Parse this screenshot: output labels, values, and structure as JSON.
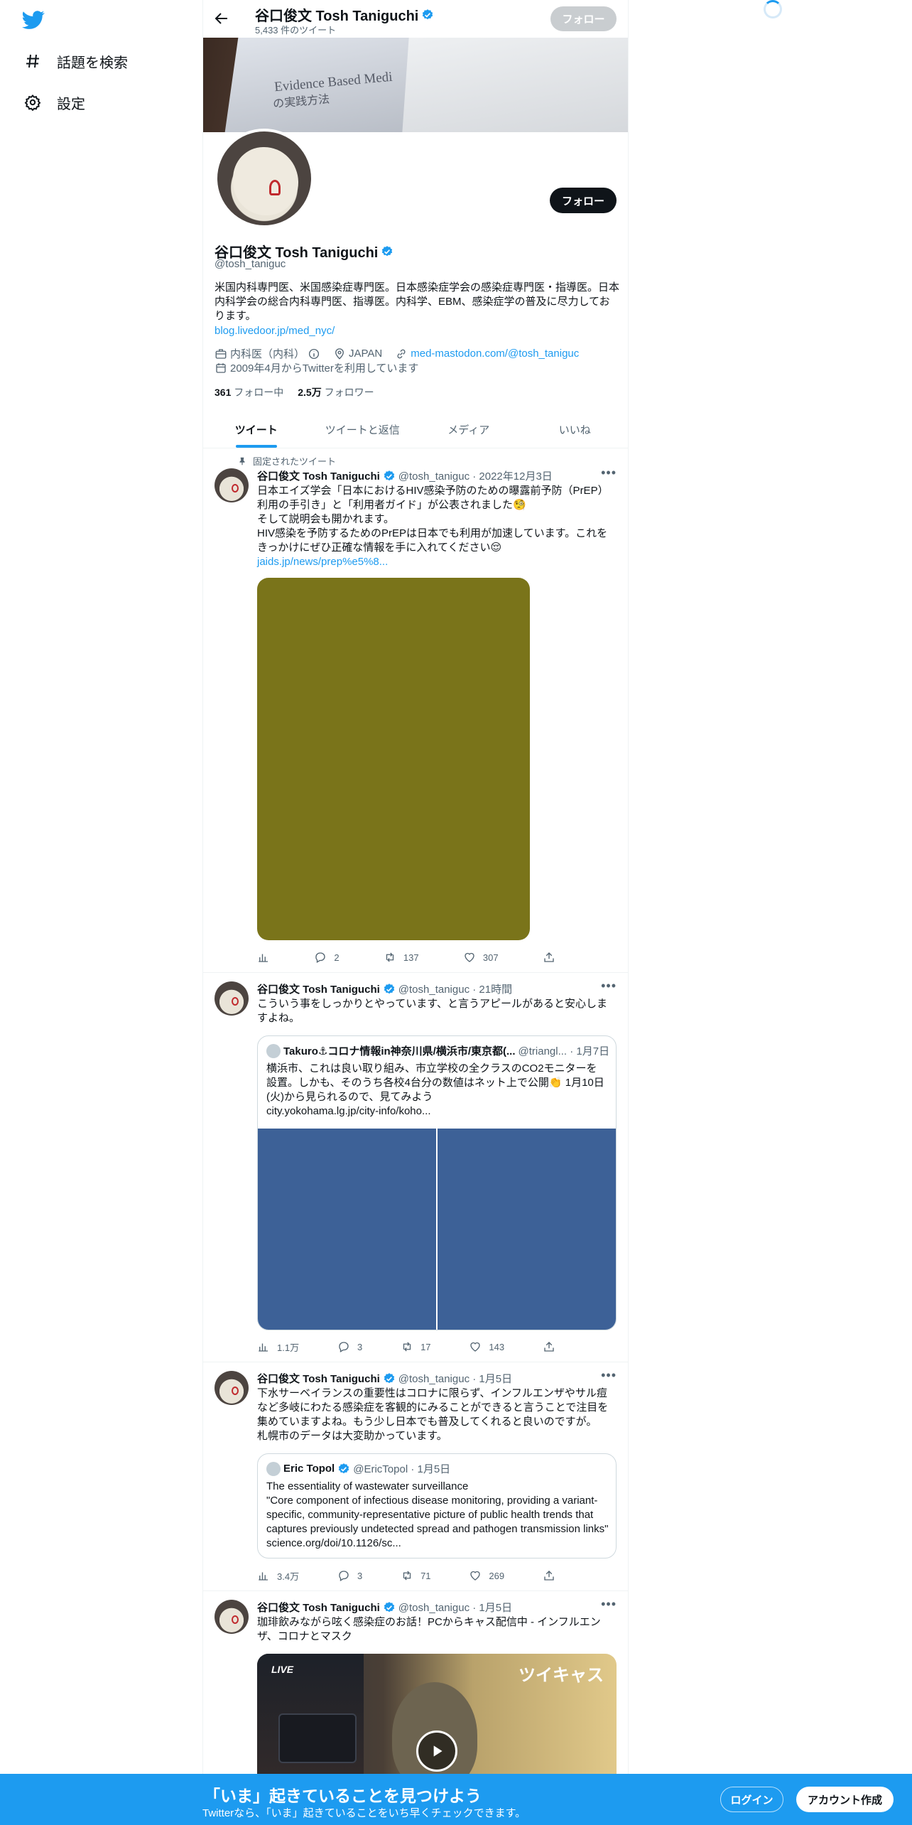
{
  "nav": {
    "explore_label": "話題を検索",
    "settings_label": "設定"
  },
  "topbar": {
    "name": "谷口俊文 Tosh Taniguchi",
    "tweet_count": "5,433 件のツイート",
    "follow_label": "フォロー"
  },
  "banner": {
    "title": "Evidence Based Medi",
    "subtitle": "の実践方法"
  },
  "profile": {
    "follow_label": "フォロー",
    "name": "谷口俊文 Tosh Taniguchi",
    "handle": "@tosh_taniguc",
    "bio": "米国内科専門医、米国感染症専門医。日本感染症学会の感染症専門医・指導医。日本内科学会の総合内科専門医、指導医。内科学、EBM、感染症学の普及に尽力しております。",
    "link": "blog.livedoor.jp/med_nyc/",
    "category": "内科医（内科）",
    "location": "JAPAN",
    "website": "med-mastodon.com/@tosh_taniguc",
    "joined": "2009年4月からTwitterを利用しています",
    "following_count": "361",
    "following_label": "フォロー中",
    "followers_count": "2.5万",
    "followers_label": "フォロワー"
  },
  "tabs": [
    "ツイート",
    "ツイートと返信",
    "メディア",
    "いいね"
  ],
  "tweets": [
    {
      "pinned_label": "固定されたツイート",
      "name": "谷口俊文 Tosh Taniguchi",
      "meta": "@tosh_taniguc · 2022年12月3日",
      "lines": [
        "日本エイズ学会「日本におけるHIV感染予防のための曝露前予防（PrEP）",
        "利用の手引き」と「利用者ガイド」が公表されました🧐",
        "そして説明会も開かれます。",
        "HIV感染を予防するためのPrEPは日本でも利用が加速しています。これを",
        "きっかけにぜひ正確な情報を手に入れてください😌"
      ],
      "link": "jaids.jp/news/prep%e5%8...",
      "stats": {
        "views": "",
        "replies": "2",
        "retweets": "137",
        "likes": "307"
      },
      "media_color": "#7a741a"
    },
    {
      "name": "谷口俊文 Tosh Taniguchi",
      "meta": "@tosh_taniguc · 21時間",
      "lines": [
        "こういう事をしっかりとやっています、と言うアピールがあると安心しま",
        "すよね。"
      ],
      "quote": {
        "name": "Takuro⚓コロナ情報in神奈川県/横浜市/東京都(...",
        "meta": "@triangl... · 1月7日",
        "lines": [
          "横浜市、これは良い取り組み、市立学校の全クラスのCO2モニターを",
          "設置。しかも、そのうち各校4台分の数値はネット上で公開👏 1月10日",
          "(火)から見られるので、見てみよう",
          "city.yokohama.lg.jp/city-info/koho..."
        ]
      },
      "stats": {
        "views": "1.1万",
        "replies": "3",
        "retweets": "17",
        "likes": "143"
      },
      "media_color": "#3d6197"
    },
    {
      "name": "谷口俊文 Tosh Taniguchi",
      "meta": "@tosh_taniguc · 1月5日",
      "lines": [
        "下水サーベイランスの重要性はコロナに限らず、インフルエンザやサル痘",
        "など多岐にわたる感染症を客観的にみることができると言うことで注目を",
        "集めていますよね。もう少し日本でも普及してくれると良いのですが。",
        "札幌市のデータは大変助かっています。"
      ],
      "quote": {
        "name": "Eric Topol",
        "meta": "@EricTopol · 1月5日",
        "lines": [
          "The essentiality of wastewater surveillance",
          "\"Core component of infectious disease monitoring, providing a variant-",
          "specific, community-representative picture of public health trends that",
          "captures previously undetected spread and pathogen transmission links\"",
          "science.org/doi/10.1126/sc..."
        ]
      },
      "stats": {
        "views": "3.4万",
        "replies": "3",
        "retweets": "71",
        "likes": "269"
      }
    },
    {
      "name": "谷口俊文 Tosh Taniguchi",
      "meta": "@tosh_taniguc · 1月5日",
      "lines": [
        "珈琲飲みながら呟く感染症のお話！PCからキャス配信中 - インフルエン",
        "ザ、コロナとマスク"
      ],
      "card": {
        "live_label": "LIVE",
        "brand": "ツイキャス"
      }
    }
  ],
  "bottombar": {
    "title": "「いま」起きていることを見つけよう",
    "subtitle": "Twitterなら、「いま」起きていることをいち早くチェックできます。",
    "login_label": "ログイン",
    "signup_label": "アカウント作成"
  },
  "colors": {
    "accent": "#1d9bf0",
    "text": "#0f1419",
    "secondary": "#536471"
  }
}
